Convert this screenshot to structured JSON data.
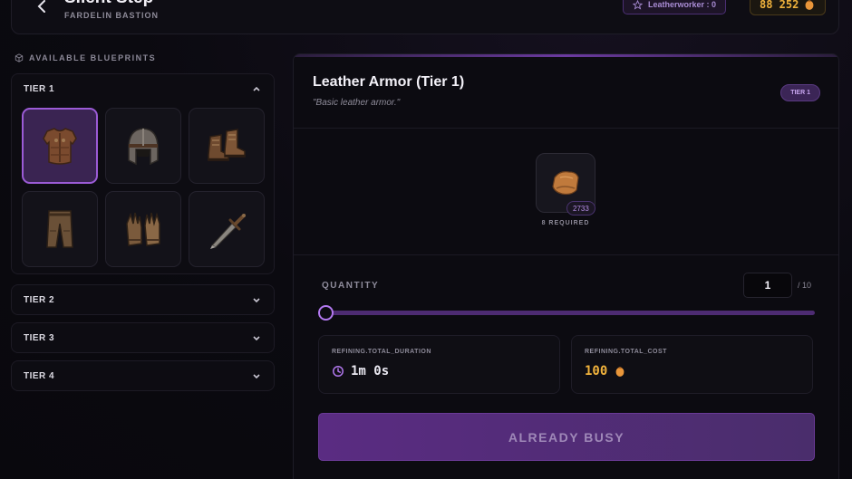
{
  "header": {
    "title": "Silent Step",
    "location": "FARDELIN BASTION",
    "profession": "Leatherworker : 0",
    "gold": "88 252"
  },
  "sidebar": {
    "section_label": "AVAILABLE BLUEPRINTS",
    "tiers": [
      {
        "label": "TIER 1",
        "expanded": true
      },
      {
        "label": "TIER 2",
        "expanded": false
      },
      {
        "label": "TIER 3",
        "expanded": false
      },
      {
        "label": "TIER 4",
        "expanded": false
      }
    ],
    "blueprints": [
      {
        "name": "leather-armor",
        "icon": "chest-armor-icon",
        "selected": true
      },
      {
        "name": "leather-helmet",
        "icon": "helmet-icon",
        "selected": false
      },
      {
        "name": "leather-boots",
        "icon": "boots-icon",
        "selected": false
      },
      {
        "name": "leather-pants",
        "icon": "pants-icon",
        "selected": false
      },
      {
        "name": "leather-gloves",
        "icon": "gloves-icon",
        "selected": false
      },
      {
        "name": "dagger",
        "icon": "dagger-icon",
        "selected": false
      }
    ]
  },
  "detail": {
    "title": "Leather Armor (Tier 1)",
    "description": "\"Basic leather armor.\"",
    "tier_chip": "TIER 1",
    "material": {
      "icon": "leather-hide-icon",
      "owned": "2733",
      "required": "8 REQUIRED"
    },
    "quantity": {
      "label": "QUANTITY",
      "value": "1",
      "max": "/ 10",
      "fraction": 0.0
    },
    "duration": {
      "label": "REFINING.TOTAL_DURATION",
      "value": "1m 0s"
    },
    "cost": {
      "label": "REFINING.TOTAL_COST",
      "value": "100"
    },
    "action_label": "ALREADY BUSY"
  },
  "colors": {
    "accent": "#9b5bd6",
    "gold": "#f0b23c",
    "background": "#0b0a10"
  }
}
